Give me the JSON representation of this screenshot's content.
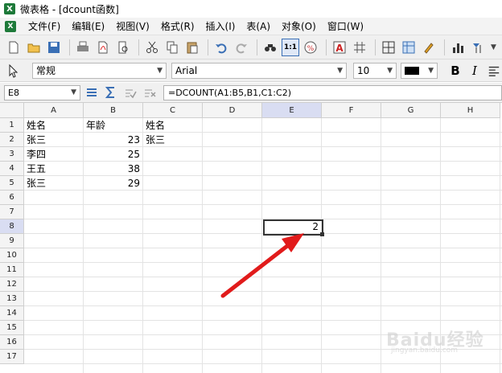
{
  "window": {
    "app_icon": "X",
    "title": "微表格 - [dcount函数]"
  },
  "menubar": {
    "icon": "X",
    "items": [
      "文件(F)",
      "编辑(E)",
      "视图(V)",
      "格式(R)",
      "插入(I)",
      "表(A)",
      "对象(O)",
      "窗口(W)"
    ]
  },
  "toolbar": {
    "icons": [
      "new-icon",
      "open-icon",
      "save-icon",
      "print-icon",
      "pdf-icon",
      "print-preview-icon",
      "cut-icon",
      "copy-icon",
      "paste-icon",
      "undo-icon",
      "redo-icon",
      "find-icon",
      "zoom-1to1-icon",
      "percent-icon",
      "text-color-icon",
      "grid-icon",
      "borders-icon",
      "table-icon",
      "format-paint-icon",
      "column-chart-icon",
      "sort-icon"
    ],
    "zoom_label": "1:1"
  },
  "format": {
    "style_value": "常规",
    "font_value": "Arial",
    "size_value": "10",
    "bold": "B",
    "italic": "I"
  },
  "formula": {
    "cell_ref": "E8",
    "value": "=DCOUNT(A1:B5,B1,C1:C2)"
  },
  "sheet": {
    "columns": [
      "A",
      "B",
      "C",
      "D",
      "E",
      "F",
      "G",
      "H"
    ],
    "rows": [
      "1",
      "2",
      "3",
      "4",
      "5",
      "6",
      "7",
      "8",
      "9",
      "10",
      "11",
      "12",
      "13",
      "14",
      "15",
      "16",
      "17"
    ],
    "cells": {
      "A1": "姓名",
      "B1": "年龄",
      "C1": "姓名",
      "A2": "张三",
      "B2": "23",
      "C2": "张三",
      "A3": "李四",
      "B3": "25",
      "A4": "王五",
      "B4": "38",
      "A5": "张三",
      "B5": "29",
      "E8": "2"
    },
    "selected_cell": "E8"
  },
  "colors": {
    "accent": "#d9ddf2",
    "arrow": "#e11b1b"
  }
}
